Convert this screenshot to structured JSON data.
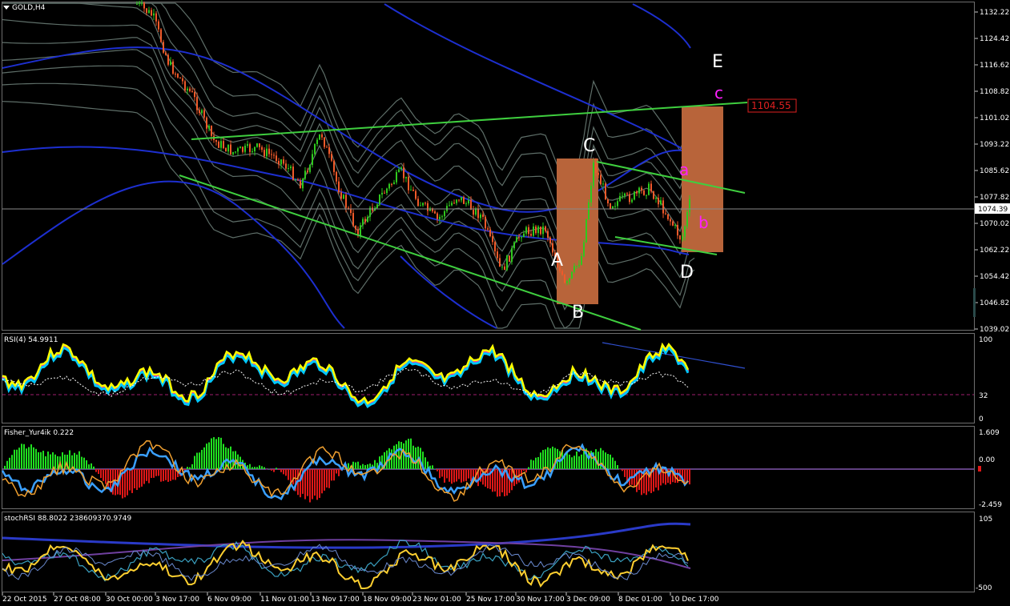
{
  "window": {
    "title": "GOLD,H4",
    "menu_icon": "triangle-down-icon"
  },
  "main_panel": {
    "current_price": "1074.39",
    "target_price": "1104.55",
    "price_ticks": [
      "1132.22",
      "1124.42",
      "1116.62",
      "1108.82",
      "1101.02",
      "1093.22",
      "1085.62",
      "1077.82",
      "1070.02",
      "1062.22",
      "1054.42",
      "1046.82",
      "1039.02"
    ],
    "wave_labels": {
      "E": "E",
      "c": "c",
      "C": "C",
      "a": "a",
      "b": "b",
      "A": "A",
      "B": "B",
      "D": "D"
    }
  },
  "rsi_panel": {
    "title": "RSI(4) 54.9911",
    "ticks": [
      "100",
      "32",
      "0"
    ]
  },
  "fisher_panel": {
    "title": "Fisher_Yur4ik 0.222",
    "ticks": [
      "1.609",
      "0.00",
      "-2.459"
    ]
  },
  "stochrsi_panel": {
    "title": "stochRSI 88.8022 238609370.9749",
    "ticks": [
      "105",
      "-500"
    ]
  },
  "time_axis": [
    "22 Oct 2015",
    "27 Oct 08:00",
    "30 Oct 00:00",
    "3 Nov 17:00",
    "6 Nov 09:00",
    "11 Nov 01:00",
    "13 Nov 17:00",
    "18 Nov 09:00",
    "23 Nov 01:00",
    "25 Nov 17:00",
    "30 Nov 17:00",
    "3 Dec 09:00",
    "8 Dec 01:00",
    "10 Dec 17:00"
  ],
  "colors": {
    "background": "#000000",
    "grid": "#5a5a5a",
    "bull": "#2fc81e",
    "bear": "#f05a2a",
    "trend": "#3fcf3f",
    "box": "#b8643a",
    "envelope": "#5e6e68",
    "ma_blue": "#1d2fd0",
    "rsi": "#ffff00",
    "rsi_band1": "#ff2d9f",
    "rsi_band2": "#00c8ff",
    "fisher_pos": "#20e020",
    "fisher_neg": "#e01818",
    "fisher_line1": "#3aa0ff",
    "fisher_line2": "#f0a030",
    "magenta": "#ff20ff"
  }
}
